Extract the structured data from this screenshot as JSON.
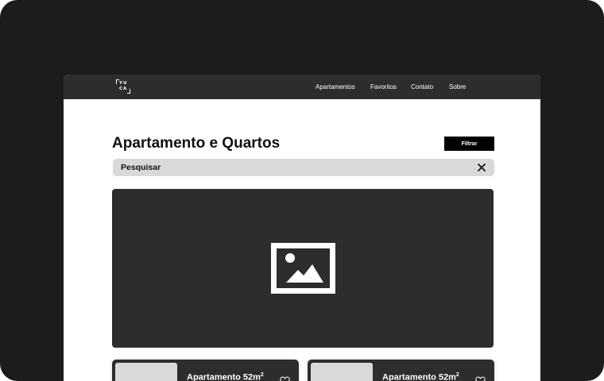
{
  "navbar": {
    "logo": {
      "line1": "YU",
      "line2": "CA"
    },
    "links": [
      "Apartamentos",
      "Favoritos",
      "Contato",
      "Sobre"
    ]
  },
  "main": {
    "title": "Apartamento e Quartos",
    "filter_label": "Filtrar",
    "search": {
      "value": "",
      "placeholder": "Pesquisar"
    },
    "hero_icon": "image-placeholder-icon"
  },
  "cards": [
    {
      "title": "Apartamento 52m",
      "unit_exp": "2",
      "icon": "heart-icon"
    },
    {
      "title": "Apartamento 52m",
      "unit_exp": "2",
      "icon": "heart-icon"
    }
  ],
  "colors": {
    "outer_background": "#1c1c1c",
    "navbar": "#2e2d2e",
    "hero": "#2e2c2d",
    "search_background": "#d9d9d9",
    "button": "#000000"
  }
}
